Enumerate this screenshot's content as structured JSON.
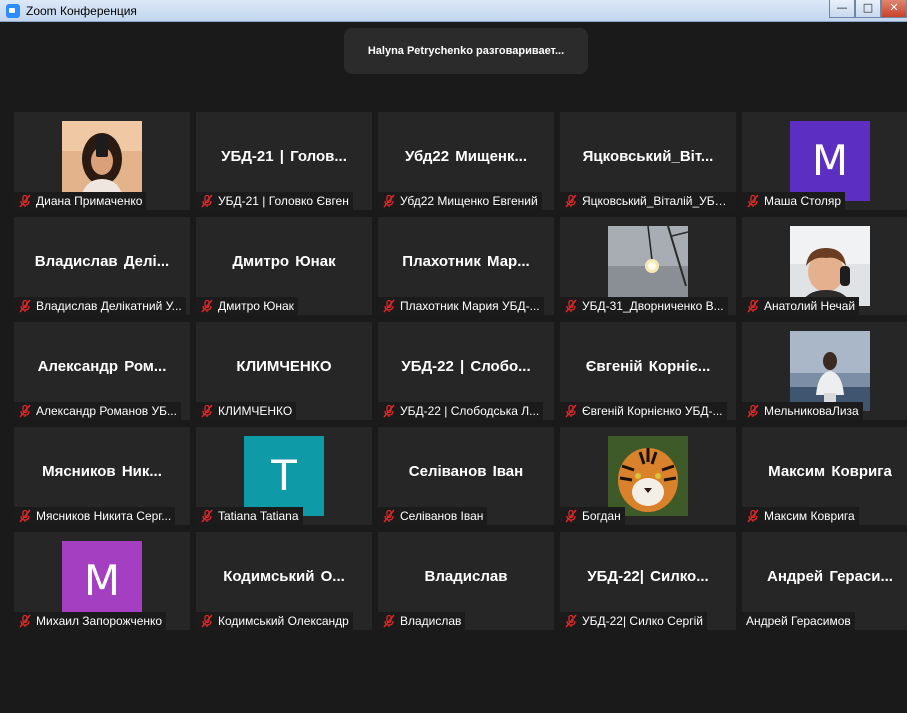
{
  "window": {
    "title": "Zoom Конференция",
    "min_glyph": "—",
    "max_glyph": "□",
    "close_glyph": "✕"
  },
  "speaker_banner": "Halyna Petrychenko разговаривает...",
  "participants": [
    {
      "display": "photo",
      "photo": "girl-selfie",
      "label": "Диана Примаченко",
      "muted": true
    },
    {
      "display": "name",
      "big": "УБД-21 | Голов...",
      "label": "УБД-21 | Головко Євген",
      "muted": true
    },
    {
      "display": "name",
      "big": "Убд22 Мищенк...",
      "label": "Убд22 Мищенко Евгений",
      "muted": true
    },
    {
      "display": "name",
      "big": "Яцковський_Віт...",
      "label": "Яцковський_Віталій_УБД...",
      "muted": true
    },
    {
      "display": "avatar",
      "letter": "M",
      "color": "#5c2fc2",
      "label": "Маша Столяр",
      "muted": true
    },
    {
      "display": "name",
      "big": "Владислав Делі...",
      "label": "Владислав Делікатний У...",
      "muted": true
    },
    {
      "display": "name",
      "big": "Дмитро Юнак",
      "label": "Дмитро Юнак",
      "muted": true
    },
    {
      "display": "name",
      "big": "Плахотник Мар...",
      "label": "Плахотник Мария УБД-...",
      "muted": true
    },
    {
      "display": "photo",
      "photo": "light-bulb",
      "label": "УБД-31_Дворниченко В...",
      "muted": true
    },
    {
      "display": "photo",
      "photo": "boy-headphones",
      "label": "Анатолий Нечай",
      "muted": true
    },
    {
      "display": "name",
      "big": "Александр Ром...",
      "label": "Александр Романов УБ...",
      "muted": true
    },
    {
      "display": "name",
      "big": "КЛИМЧЕНКО",
      "label": "КЛИМЧЕНКО",
      "muted": true
    },
    {
      "display": "name",
      "big": "УБД-22 | Слобо...",
      "label": "УБД-22 | Слободська Л...",
      "muted": true
    },
    {
      "display": "name",
      "big": "Євгеній Корніє...",
      "label": "Євгеній Корнієнко УБД-...",
      "muted": true
    },
    {
      "display": "photo",
      "photo": "girl-sea",
      "label": "МельниковаЛиза",
      "muted": true
    },
    {
      "display": "name",
      "big": "Мясников Ник...",
      "label": "Мясников Никита Серг...",
      "muted": true
    },
    {
      "display": "avatar",
      "letter": "T",
      "color": "#0e9aa7",
      "label": "Tatiana Tatiana",
      "muted": true
    },
    {
      "display": "name",
      "big": "Селіванов Іван",
      "label": "Селіванов Іван",
      "muted": true
    },
    {
      "display": "photo",
      "photo": "tiger",
      "label": "Богдан",
      "muted": true
    },
    {
      "display": "name",
      "big": "Максим Коврига",
      "label": "Максим Коврига",
      "muted": true
    },
    {
      "display": "avatar",
      "letter": "M",
      "color": "#a43fc2",
      "label": "Михаил Запорожченко",
      "muted": true
    },
    {
      "display": "name",
      "big": "Кодимський О...",
      "label": "Кодимський Олександр",
      "muted": true
    },
    {
      "display": "name",
      "big": "Владислав",
      "label": "Владислав",
      "muted": true
    },
    {
      "display": "name",
      "big": "УБД-22| Силко...",
      "label": "УБД-22| Силко Сергій",
      "muted": true
    },
    {
      "display": "name",
      "big": "Андрей Гераси...",
      "label": "Андрей Герасимов",
      "muted": false
    }
  ],
  "colors": {
    "muted_mic": "#e02828",
    "tile_bg": "#262626",
    "stage_bg": "#1a1a1a"
  }
}
